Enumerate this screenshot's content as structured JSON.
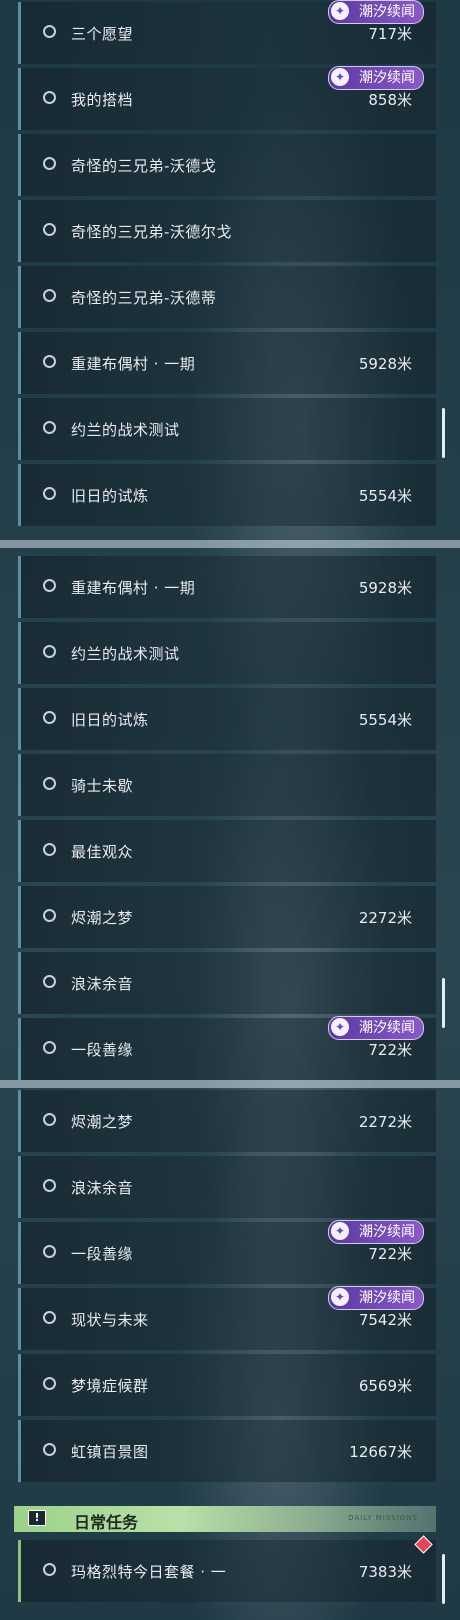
{
  "panels": [
    {
      "rows": [
        {
          "label": "三个愿望",
          "distance": "717米",
          "badge": "潮汐续闻"
        },
        {
          "label": "我的搭档",
          "distance": "858米",
          "badge": "潮汐续闻"
        },
        {
          "label": "奇怪的三兄弟-沃德戈",
          "distance": "",
          "badge": ""
        },
        {
          "label": "奇怪的三兄弟-沃德尔戈",
          "distance": "",
          "badge": ""
        },
        {
          "label": "奇怪的三兄弟-沃德蒂",
          "distance": "",
          "badge": ""
        },
        {
          "label": "重建布偶村 · 一期",
          "distance": "5928米",
          "badge": ""
        },
        {
          "label": "约兰的战术测试",
          "distance": "",
          "badge": ""
        },
        {
          "label": "旧日的试炼",
          "distance": "5554米",
          "badge": ""
        }
      ]
    },
    {
      "rows": [
        {
          "label": "重建布偶村 · 一期",
          "distance": "5928米",
          "badge": ""
        },
        {
          "label": "约兰的战术测试",
          "distance": "",
          "badge": ""
        },
        {
          "label": "旧日的试炼",
          "distance": "5554米",
          "badge": ""
        },
        {
          "label": "骑士未歇",
          "distance": "",
          "badge": ""
        },
        {
          "label": "最佳观众",
          "distance": "",
          "badge": ""
        },
        {
          "label": "烬潮之梦",
          "distance": "2272米",
          "badge": ""
        },
        {
          "label": "浪沫余音",
          "distance": "",
          "badge": ""
        },
        {
          "label": "一段善缘",
          "distance": "722米",
          "badge": "潮汐续闻"
        }
      ]
    },
    {
      "rows": [
        {
          "label": "烬潮之梦",
          "distance": "2272米",
          "badge": ""
        },
        {
          "label": "浪沫余音",
          "distance": "",
          "badge": ""
        },
        {
          "label": "一段善缘",
          "distance": "722米",
          "badge": "潮汐续闻"
        },
        {
          "label": "现状与未来",
          "distance": "7542米",
          "badge": "潮汐续闻"
        },
        {
          "label": "梦境症候群",
          "distance": "6569米",
          "badge": ""
        },
        {
          "label": "虹镇百景图",
          "distance": "12667米",
          "badge": ""
        }
      ],
      "daily_section": {
        "title": "日常任务",
        "tag": "DAILY MISSIONS",
        "rows": [
          {
            "label": "玛格烈特今日套餐 · 一",
            "distance": "7383米"
          }
        ]
      }
    }
  ],
  "colors": {
    "badge_purple": "#7a4fc0",
    "daily_green": "#a8d898",
    "row_accent": "#5d8fa3",
    "alert_red": "#e0465c"
  },
  "icons": {
    "row_status": "circle-outline-icon",
    "badge": "tide-story-icon",
    "daily": "exclamation-icon",
    "alert": "diamond-alert-icon"
  }
}
